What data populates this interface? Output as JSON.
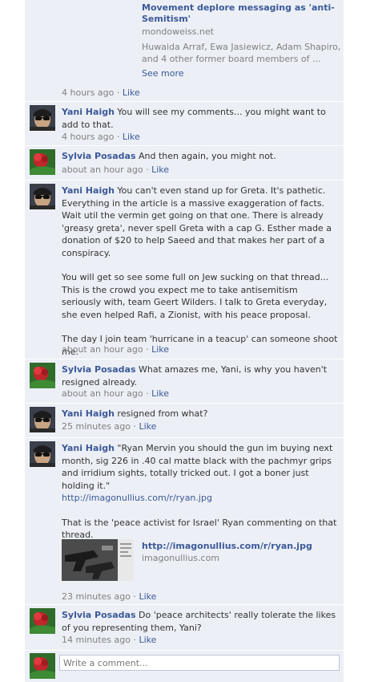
{
  "shared_link": {
    "title": "Movement deplore messaging as 'anti-Semitism'",
    "domain": "mondoweiss.net",
    "description": "Huwaida Arraf, Ewa Jasiewicz, Adam Shapiro, and 4 other former board members of ...",
    "see_more": "See more",
    "time": "4 hours ago",
    "like": "Like"
  },
  "separator": " · ",
  "comments": [
    {
      "author": "Yani Haigh",
      "paragraphs": [
        "You will see my comments... you might want to add to that."
      ],
      "time": "4 hours ago",
      "like": "Like",
      "avatar": "man-sunglasses-avatar"
    },
    {
      "author": "Sylvia Posadas",
      "paragraphs": [
        "And then again, you might not."
      ],
      "time": "about an hour ago",
      "like": "Like",
      "avatar": "flower-avatar"
    },
    {
      "author": "Yani Haigh",
      "paragraphs": [
        "You can't even stand up for Greta. It's pathetic. Everything in the article is a massive exaggeration of facts. Wait util the vermin get going on that one. There is already 'greasy greta', never spell Greta with a cap G. Esther made a donation of $20 to help Saeed and that makes her part of a conspiracy.",
        "You will get so see some full on Jew sucking on that thread... This is the crowd you expect me to take antisemitism seriously with, team Geert Wilders. I talk to Greta everyday, she even helped Rafi, a Zionist, with his peace proposal.",
        "The day I join team 'hurricane in a teacup' can someone shoot me."
      ],
      "time": "about an hour ago",
      "like": "Like",
      "avatar": "man-sunglasses-avatar"
    },
    {
      "author": "Sylvia Posadas",
      "paragraphs": [
        "What amazes me, Yani, is why you haven't resigned already."
      ],
      "time": "about an hour ago",
      "like": "Like",
      "avatar": "flower-avatar"
    },
    {
      "author": "Yani Haigh",
      "paragraphs": [
        "resigned from what?"
      ],
      "time": "25 minutes ago",
      "like": "Like",
      "avatar": "man-sunglasses-avatar"
    },
    {
      "author": "Yani Haigh",
      "paragraphs": [
        "\"Ryan Mervin you should the gun im buying next month, sig 226 in .40 cal matte black with the pachmyr grips and irridium sights, totally tricked out. I got a boner just holding it.\"",
        "That is the 'peace activist for Israel' Ryan commenting on that thread."
      ],
      "url": "http://imagonullius.com/r/ryan.jpg",
      "link_card": {
        "title": "http://imagonullius.com/r/ryan.jpg",
        "domain": "imagonullius.com"
      },
      "time": "23 minutes ago",
      "like": "Like",
      "avatar": "man-sunglasses-avatar"
    },
    {
      "author": "Sylvia Posadas",
      "paragraphs": [
        "Do 'peace architects' really tolerate the likes of you representing them, Yani?"
      ],
      "time": "14 minutes ago",
      "like": "Like",
      "avatar": "flower-avatar"
    }
  ],
  "composer": {
    "placeholder": "Write a comment...",
    "avatar": "flower-avatar"
  }
}
